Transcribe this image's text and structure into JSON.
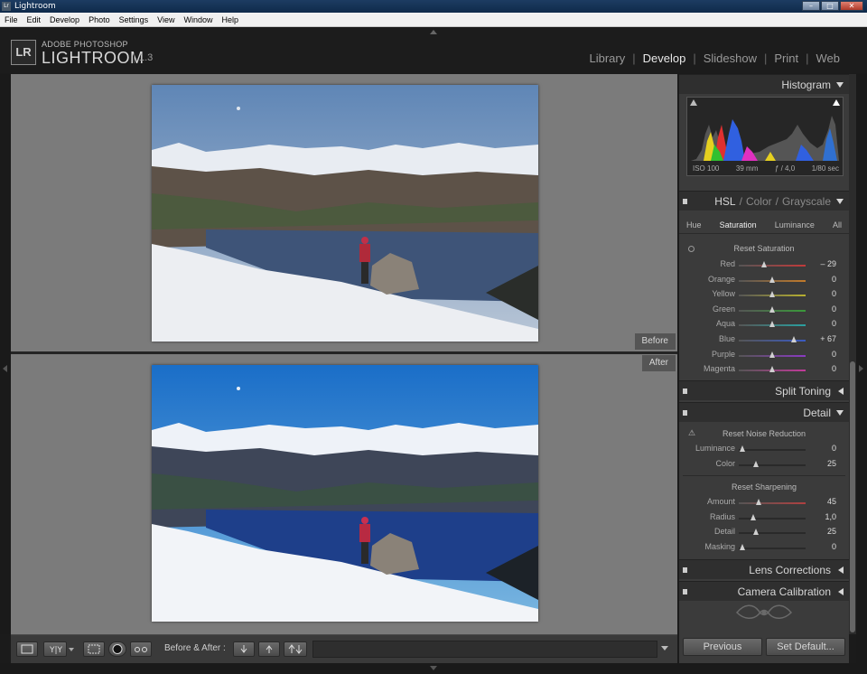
{
  "window": {
    "title": "Lightroom"
  },
  "menu": [
    "File",
    "Edit",
    "Develop",
    "Photo",
    "Settings",
    "View",
    "Window",
    "Help"
  ],
  "brand": {
    "badge": "LR",
    "top": "ADOBE PHOTOSHOP",
    "main": "LIGHTROOM",
    "version": "1.3"
  },
  "modules": [
    {
      "label": "Library",
      "active": false
    },
    {
      "label": "Develop",
      "active": true
    },
    {
      "label": "Slideshow",
      "active": false
    },
    {
      "label": "Print",
      "active": false
    },
    {
      "label": "Web",
      "active": false
    }
  ],
  "view": {
    "before_label": "Before",
    "after_label": "After"
  },
  "toolbar": {
    "before_after_label": "Before & After :"
  },
  "histogram": {
    "title": "Histogram",
    "iso": "ISO 100",
    "focal": "39 mm",
    "aperture": "ƒ / 4,0",
    "shutter": "1/80 sec"
  },
  "hsl": {
    "title_hsl": "HSL",
    "title_sep": "/",
    "title_color": "Color",
    "title_grayscale": "Grayscale",
    "tabs": [
      "Hue",
      "Saturation",
      "Luminance",
      "All"
    ],
    "active_tab": "Saturation",
    "reset": "Reset Saturation",
    "rows": [
      {
        "label": "Red",
        "value": "– 29",
        "pos": 0.38,
        "color": "#c23a3a"
      },
      {
        "label": "Orange",
        "value": "0",
        "pos": 0.5,
        "color": "#c27a2a"
      },
      {
        "label": "Yellow",
        "value": "0",
        "pos": 0.5,
        "color": "#b8b030"
      },
      {
        "label": "Green",
        "value": "0",
        "pos": 0.5,
        "color": "#3a9a3a"
      },
      {
        "label": "Aqua",
        "value": "0",
        "pos": 0.5,
        "color": "#2aa0a0"
      },
      {
        "label": "Blue",
        "value": "+ 67",
        "pos": 0.82,
        "color": "#3a5ac2"
      },
      {
        "label": "Purple",
        "value": "0",
        "pos": 0.5,
        "color": "#8a3ac2"
      },
      {
        "label": "Magenta",
        "value": "0",
        "pos": 0.5,
        "color": "#c23a9a"
      }
    ]
  },
  "split_toning": {
    "title": "Split Toning"
  },
  "detail": {
    "title": "Detail",
    "noise_reset": "Reset Noise Reduction",
    "noise_rows": [
      {
        "label": "Luminance",
        "value": "0",
        "pos": 0.05
      },
      {
        "label": "Color",
        "value": "25",
        "pos": 0.25
      }
    ],
    "sharpen_reset": "Reset Sharpening",
    "sharpen_rows": [
      {
        "label": "Amount",
        "value": "45",
        "pos": 0.3,
        "color": "#b04040"
      },
      {
        "label": "Radius",
        "value": "1,0",
        "pos": 0.22
      },
      {
        "label": "Detail",
        "value": "25",
        "pos": 0.25
      },
      {
        "label": "Masking",
        "value": "0",
        "pos": 0.05
      }
    ]
  },
  "lens": {
    "title": "Lens Corrections"
  },
  "calibration": {
    "title": "Camera Calibration"
  },
  "footer": {
    "previous": "Previous",
    "set_default": "Set Default..."
  }
}
